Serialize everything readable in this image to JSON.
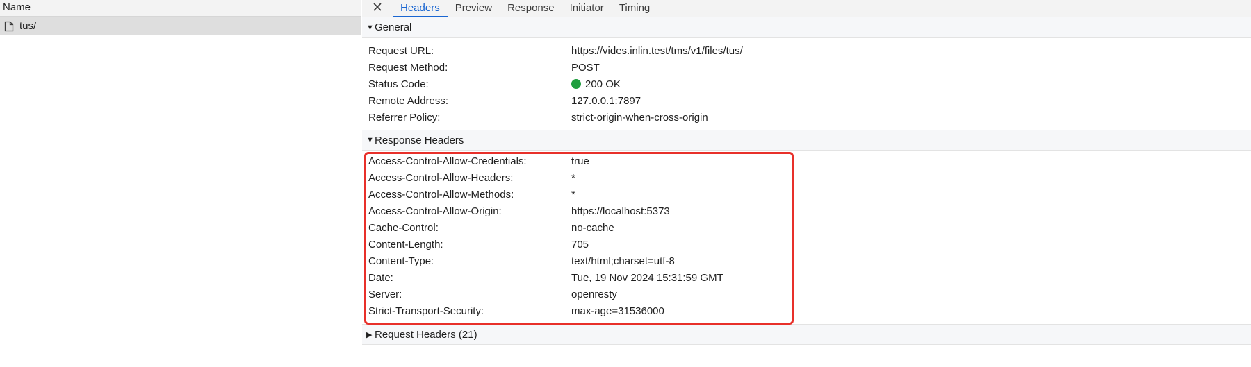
{
  "left": {
    "column_header": "Name",
    "rows": [
      {
        "name": "tus/",
        "icon": "file-icon"
      }
    ]
  },
  "tabs": {
    "close_icon": "close-icon",
    "items": [
      {
        "label": "Headers",
        "active": true
      },
      {
        "label": "Preview",
        "active": false
      },
      {
        "label": "Response",
        "active": false
      },
      {
        "label": "Initiator",
        "active": false
      },
      {
        "label": "Timing",
        "active": false
      }
    ]
  },
  "general": {
    "title": "General",
    "expanded": true,
    "rows": [
      {
        "key": "Request URL:",
        "value": "https://vides.inlin.test/tms/v1/files/tus/"
      },
      {
        "key": "Request Method:",
        "value": "POST"
      },
      {
        "key": "Status Code:",
        "value": "200 OK",
        "status_color": "#1e9e3e"
      },
      {
        "key": "Remote Address:",
        "value": "127.0.0.1:7897"
      },
      {
        "key": "Referrer Policy:",
        "value": "strict-origin-when-cross-origin"
      }
    ]
  },
  "response_headers": {
    "title": "Response Headers",
    "expanded": true,
    "highlight_color": "#e8302a",
    "rows": [
      {
        "key": "Access-Control-Allow-Credentials:",
        "value": "true"
      },
      {
        "key": "Access-Control-Allow-Headers:",
        "value": "*"
      },
      {
        "key": "Access-Control-Allow-Methods:",
        "value": "*"
      },
      {
        "key": "Access-Control-Allow-Origin:",
        "value": "https://localhost:5373"
      },
      {
        "key": "Cache-Control:",
        "value": "no-cache"
      },
      {
        "key": "Content-Length:",
        "value": "705"
      },
      {
        "key": "Content-Type:",
        "value": "text/html;charset=utf-8"
      },
      {
        "key": "Date:",
        "value": "Tue, 19 Nov 2024 15:31:59 GMT"
      },
      {
        "key": "Server:",
        "value": "openresty"
      },
      {
        "key": "Strict-Transport-Security:",
        "value": "max-age=31536000"
      }
    ]
  },
  "request_headers": {
    "title": "Request Headers (21)",
    "expanded": false
  },
  "colors": {
    "accent": "#1a66d1",
    "selected_row": "#dedede",
    "status_ok": "#1e9e3e"
  }
}
